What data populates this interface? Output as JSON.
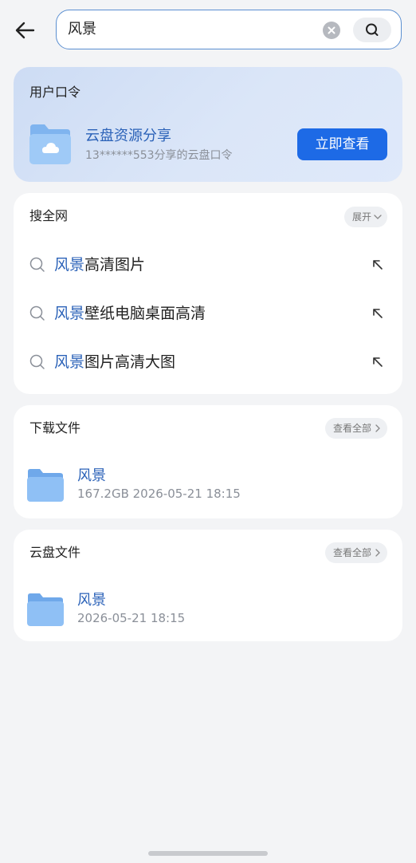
{
  "search": {
    "query": "风景"
  },
  "share_card": {
    "title": "用户口令",
    "name": "云盘资源分享",
    "subtitle": "13******553分享的云盘口令",
    "button_label": "立即查看"
  },
  "web_search": {
    "title": "搜全网",
    "expand_label": "展开",
    "items": [
      {
        "highlight": "风景",
        "rest": "高清图片"
      },
      {
        "highlight": "风景",
        "rest": "壁纸电脑桌面高清"
      },
      {
        "highlight": "风景",
        "rest": "图片高清大图"
      }
    ]
  },
  "download_files": {
    "title": "下载文件",
    "view_all_label": "查看全部",
    "items": [
      {
        "name": "风景",
        "meta": "167.2GB  2026-05-21 18:15"
      }
    ]
  },
  "cloud_files": {
    "title": "云盘文件",
    "view_all_label": "查看全部",
    "items": [
      {
        "name": "风景",
        "meta": "2026-05-21 18:15"
      }
    ]
  },
  "colors": {
    "accent": "#1d6ae6",
    "highlight_text": "#2b62b8"
  },
  "icons": [
    "back-arrow-icon",
    "clear-icon",
    "search-icon",
    "cloud-folder-icon",
    "chevron-down-icon",
    "chevron-right-icon",
    "arrow-up-left-icon",
    "folder-icon"
  ]
}
